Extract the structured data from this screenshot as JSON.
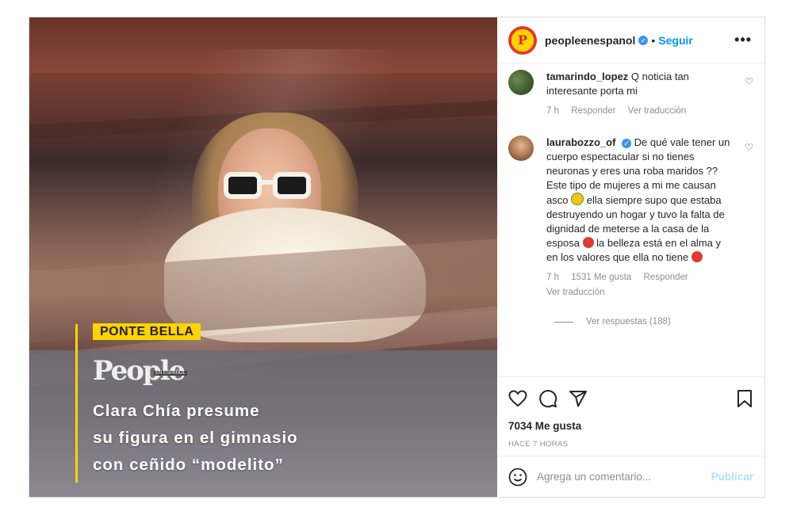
{
  "header": {
    "username": "peopleenespanol",
    "separator": "•",
    "follow_label": "Seguir",
    "more_label": "•••"
  },
  "photo": {
    "ponte_label": "PONTE BELLA",
    "logo_text": "People",
    "logo_sub": "EN ESPAÑOL",
    "headline_lines": [
      "Clara Chía presume",
      "su figura en el gimnasio",
      "con ceñido “modelito”"
    ]
  },
  "comments": [
    {
      "username": "tamarindo_lopez",
      "text": "Q noticia tan interesante porta mi",
      "time": "7 h",
      "reply_label": "Responder",
      "translate_label": "Ver traducción"
    },
    {
      "username": "laurabozzo_of",
      "text_part1": "De qué vale tener un cuerpo espectacular si no tienes neuronas y eres una roba maridos ?? Este tipo de mujeres a mi me causan asco",
      "text_part2": "ella siempre supo que estaba destruyendo un hogar y tuvo la falta de dignidad de meterse a la casa de la esposa",
      "text_part3": "la belleza está en el alma y en los valores que ella no tiene",
      "time": "7 h",
      "likes": "1531 Me gusta",
      "reply_label": "Responder",
      "translate_label": "Ver traducción",
      "view_replies": "Ver respuestas (188)"
    }
  ],
  "actions": {
    "likes": "7034 Me gusta",
    "timestamp": "HACE 7 HORAS"
  },
  "add_comment": {
    "placeholder": "Agrega un comentario...",
    "publish_label": "Publicar"
  },
  "colors": {
    "accent": "#0095f6",
    "publish_disabled": "#b2dffc",
    "ponte_yellow": "#ffd400"
  }
}
